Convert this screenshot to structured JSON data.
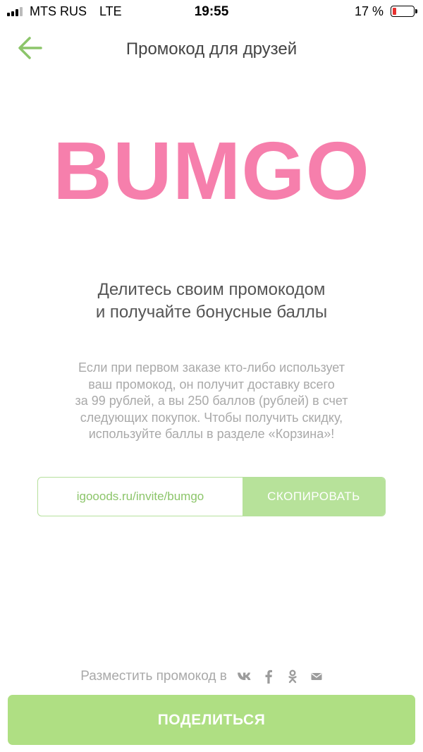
{
  "status_bar": {
    "carrier": "MTS RUS",
    "network": "LTE",
    "time": "19:55",
    "battery_percent": "17 %",
    "battery_level": 0.17
  },
  "nav": {
    "back_icon": "arrow-left-icon",
    "title": "Промокод для друзей"
  },
  "promo": {
    "code": "BUMGO"
  },
  "headline": {
    "line1": "Делитесь своим промокодом",
    "line2": "и получайте бонусные баллы"
  },
  "description": {
    "lines": [
      "Если при первом заказе кто-либо использует",
      "ваш промокод, он получит доставку всего",
      "за 99 рублей, а вы 250 баллов (рублей) в счет",
      "следующих покупок. Чтобы получить скидку,",
      "используйте баллы в разделе «Корзина»!"
    ]
  },
  "invite": {
    "link": "igooods.ru/invite/bumgo",
    "copy_label": "СКОПИРОВАТЬ"
  },
  "share": {
    "label": "Разместить промокод в",
    "icons": [
      "vk-icon",
      "facebook-icon",
      "odnoklassniki-icon",
      "mail-icon"
    ],
    "button_label": "ПОДЕЛИТЬСЯ"
  },
  "colors": {
    "accent_green": "#afdf83",
    "brand_pink": "#f67fac",
    "battery_low": "#e8312f"
  }
}
